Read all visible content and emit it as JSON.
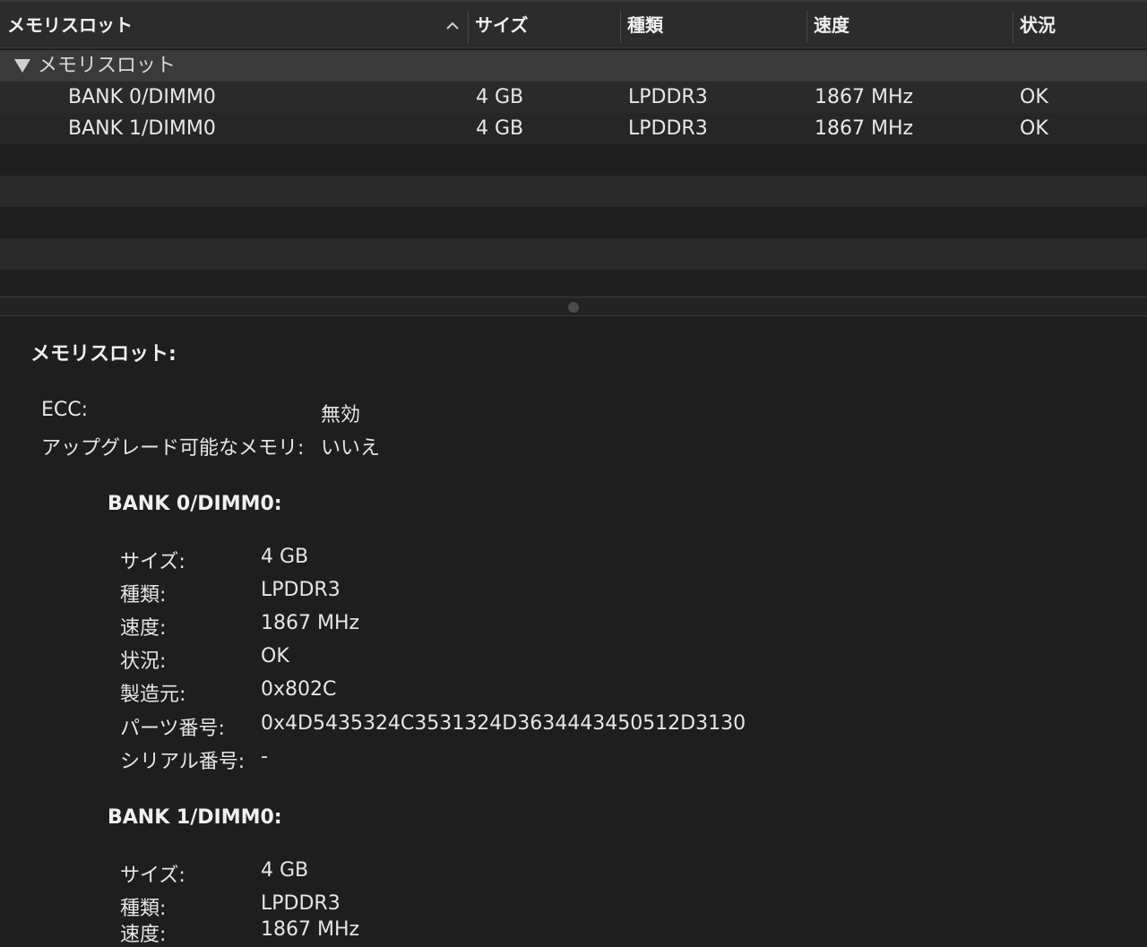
{
  "table": {
    "columns": [
      "メモリスロット",
      "サイズ",
      "種類",
      "速度",
      "状況"
    ],
    "group_label": "メモリスロット",
    "rows": [
      {
        "name": "BANK 0/DIMM0",
        "size": "4 GB",
        "type": "LPDDR3",
        "speed": "1867 MHz",
        "status": "OK"
      },
      {
        "name": "BANK 1/DIMM0",
        "size": "4 GB",
        "type": "LPDDR3",
        "speed": "1867 MHz",
        "status": "OK"
      }
    ]
  },
  "detail": {
    "title": "メモリスロット:",
    "summary": [
      {
        "label": "ECC:",
        "value": "無効"
      },
      {
        "label": "アップグレード可能なメモリ:",
        "value": "いいえ"
      }
    ],
    "banks": [
      {
        "title": "BANK 0/DIMM0:",
        "fields": [
          {
            "label": "サイズ:",
            "value": "4 GB"
          },
          {
            "label": "種類:",
            "value": "LPDDR3"
          },
          {
            "label": "速度:",
            "value": "1867 MHz"
          },
          {
            "label": "状況:",
            "value": "OK"
          },
          {
            "label": "製造元:",
            "value": "0x802C"
          },
          {
            "label": "パーツ番号:",
            "value": "0x4D5435324C3531324D3634443450512D3130"
          },
          {
            "label": "シリアル番号:",
            "value": "-"
          }
        ]
      },
      {
        "title": "BANK 1/DIMM0:",
        "fields": [
          {
            "label": "サイズ:",
            "value": "4 GB"
          },
          {
            "label": "種類:",
            "value": "LPDDR3"
          },
          {
            "label": "速度:",
            "value": "1867 MHz"
          }
        ]
      }
    ]
  }
}
